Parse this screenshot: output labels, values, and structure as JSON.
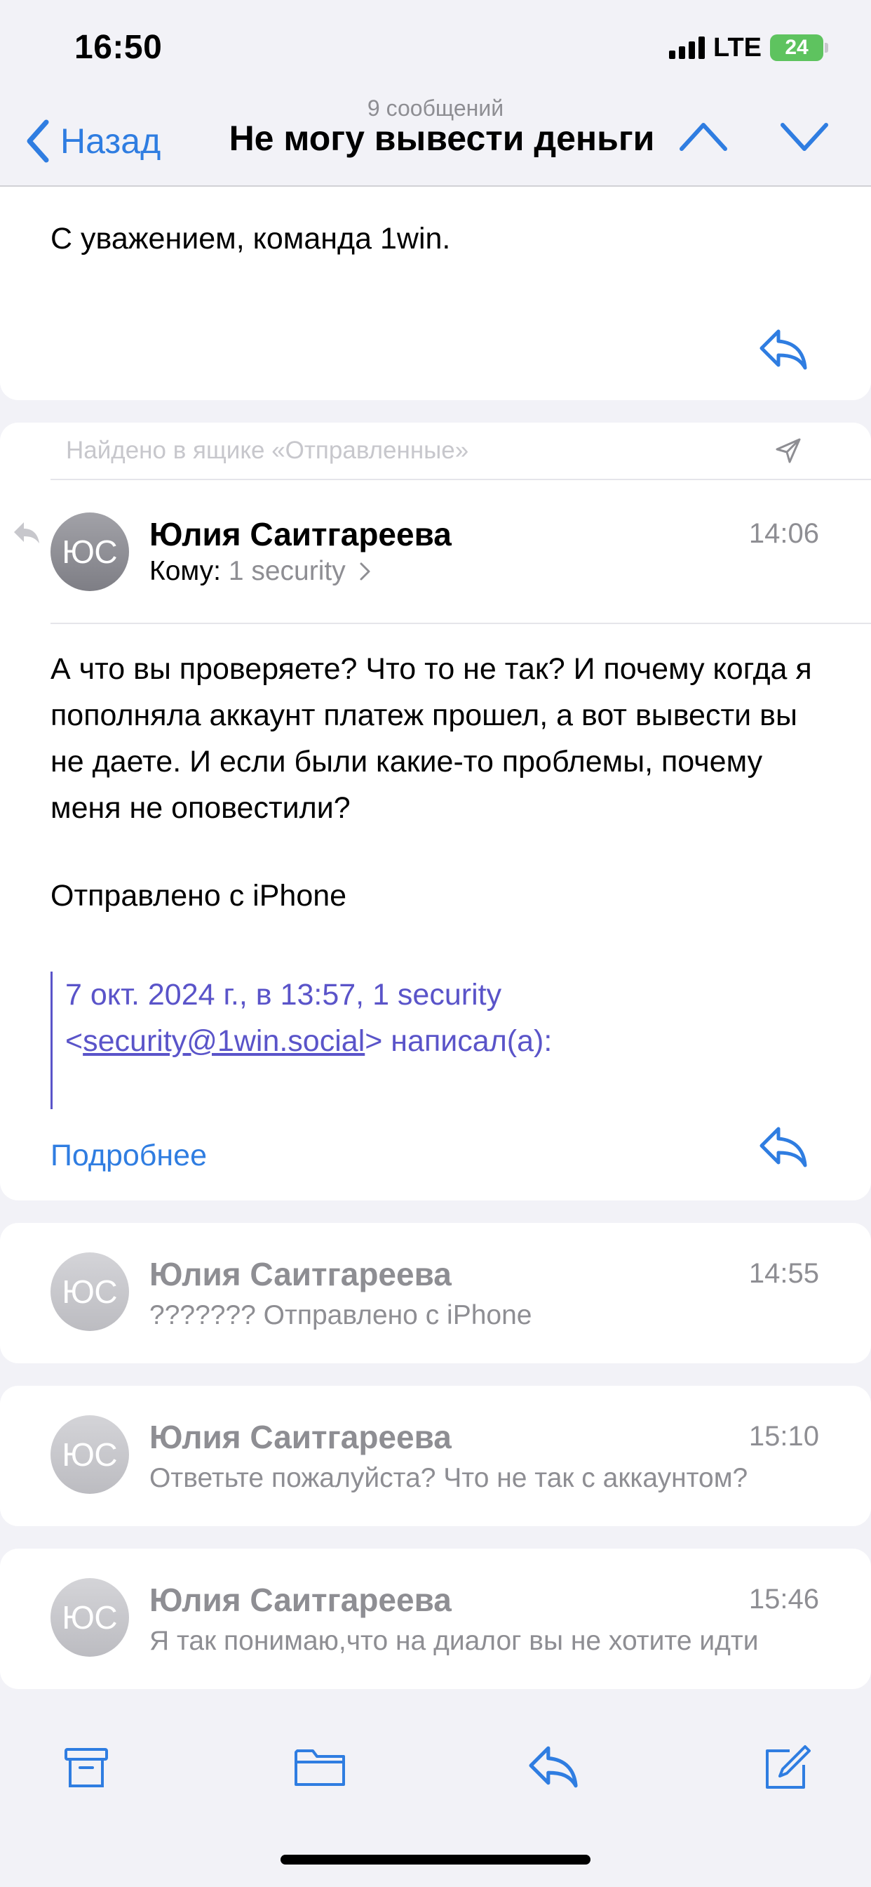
{
  "status_bar": {
    "time": "16:50",
    "network": "LTE",
    "battery": "24"
  },
  "nav": {
    "subtitle": "9 сообщений",
    "back_label": "Назад",
    "title": "Не могу вывести деньги"
  },
  "prev_message": {
    "closing": "С уважением, команда 1win."
  },
  "current_message": {
    "found_in": "Найдено в ящике «Отправленные»",
    "avatar": "ЮС",
    "sender": "Юлия Саитгареева",
    "time": "14:06",
    "to_label": "Кому:",
    "to_value": "1 security",
    "body": "А что вы проверяете? Что то не так? И почему когда я пополняла аккаунт платеж прошел, а вот вывести вы не даете.  И если были какие-то проблемы, почему меня не оповестили?",
    "signature": "Отправлено с iPhone",
    "quote_line1": "7 окт. 2024 г., в 13:57, 1 security",
    "quote_lt": "<",
    "quote_email": "security@1win.social",
    "quote_rest": "> написал(а):",
    "more_label": "Подробнее"
  },
  "collapsed_messages": [
    {
      "avatar": "ЮС",
      "sender": "Юлия Саитгареева",
      "time": "14:55",
      "preview": "??????? Отправлено с iPhone"
    },
    {
      "avatar": "ЮС",
      "sender": "Юлия Саитгареева",
      "time": "15:10",
      "preview": "Ответьте пожалуйста? Что не так с аккаунтом?"
    },
    {
      "avatar": "ЮС",
      "sender": "Юлия Саитгареева",
      "time": "15:46",
      "preview": "Я так понимаю,что на диалог вы не хотите идти"
    }
  ],
  "colors": {
    "accent": "#2f7de1",
    "quote": "#5a54c9",
    "secondary_text": "#8e8e93",
    "battery": "#5ec35f"
  },
  "icons": {
    "toolbar": [
      "archive-icon",
      "folder-icon",
      "reply-icon",
      "compose-icon"
    ]
  }
}
